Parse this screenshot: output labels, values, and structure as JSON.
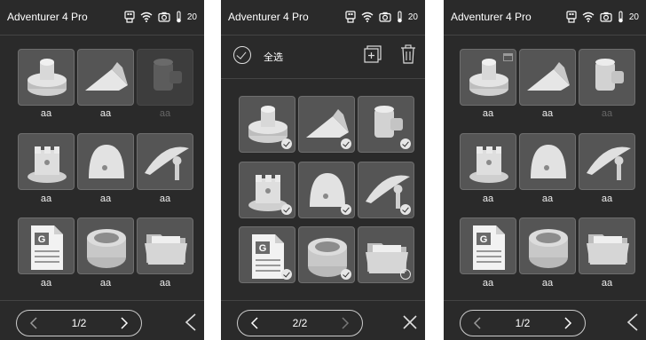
{
  "panels": [
    {
      "status": {
        "title": "Adventurer 4 Pro",
        "temp": "20",
        "icons": [
          "usb-icon",
          "wifi-icon",
          "camera-icon",
          "thermometer-icon"
        ]
      },
      "mode": "browse",
      "files": [
        {
          "label": "aa",
          "thumb": "gear-part",
          "dim": false
        },
        {
          "label": "aa",
          "thumb": "wing-part",
          "dim": false
        },
        {
          "label": "aa",
          "thumb": "pipe-part",
          "dim": true
        },
        {
          "label": "aa",
          "thumb": "castle-nut",
          "dim": false
        },
        {
          "label": "aa",
          "thumb": "dome",
          "dim": false
        },
        {
          "label": "aa",
          "thumb": "fender",
          "dim": false
        },
        {
          "label": "aa",
          "thumb": "gcode-file",
          "dim": false
        },
        {
          "label": "aa",
          "thumb": "ring-sculpture",
          "dim": false
        },
        {
          "label": "aa",
          "thumb": "folder",
          "dim": false
        }
      ],
      "pager": {
        "text": "1/2"
      },
      "side_button": "back-icon"
    },
    {
      "status": {
        "title": "Adventurer 4 Pro",
        "temp": "20",
        "icons": [
          "usb-icon",
          "wifi-icon",
          "camera-icon",
          "thermometer-icon"
        ]
      },
      "mode": "select",
      "select_all_label": "全选",
      "files": [
        {
          "thumb": "gear-part",
          "checked": true
        },
        {
          "thumb": "wing-part",
          "checked": true
        },
        {
          "thumb": "pipe-part",
          "checked": true
        },
        {
          "thumb": "castle-nut",
          "checked": true
        },
        {
          "thumb": "dome",
          "checked": true
        },
        {
          "thumb": "fender",
          "checked": true
        },
        {
          "thumb": "gcode-file",
          "checked": true
        },
        {
          "thumb": "ring-sculpture",
          "checked": true
        },
        {
          "thumb": "folder",
          "checked": false
        }
      ],
      "pager": {
        "text": "2/2"
      },
      "side_button": "close-icon"
    },
    {
      "status": {
        "title": "Adventurer 4 Pro",
        "temp": "20",
        "icons": [
          "usb-icon",
          "wifi-icon",
          "camera-icon",
          "thermometer-icon"
        ]
      },
      "mode": "browse",
      "files": [
        {
          "label": "aa",
          "thumb": "gear-part",
          "dim": false,
          "badge": true
        },
        {
          "label": "aa",
          "thumb": "wing-part",
          "dim": false
        },
        {
          "label": "aa",
          "thumb": "pipe-part",
          "dim": false,
          "label_dim": true
        },
        {
          "label": "aa",
          "thumb": "castle-nut",
          "dim": false
        },
        {
          "label": "aa",
          "thumb": "dome",
          "dim": false
        },
        {
          "label": "aa",
          "thumb": "fender",
          "dim": false
        },
        {
          "label": "aa",
          "thumb": "gcode-file",
          "dim": false
        },
        {
          "label": "aa",
          "thumb": "ring-sculpture",
          "dim": false
        },
        {
          "label": "aa",
          "thumb": "folder",
          "dim": false
        }
      ],
      "pager": {
        "text": "1/2"
      },
      "side_button": "back-icon"
    }
  ],
  "colors": {
    "panel_bg": "#2a2a2a",
    "tile_bg": "#555555",
    "text": "#ffffff"
  }
}
